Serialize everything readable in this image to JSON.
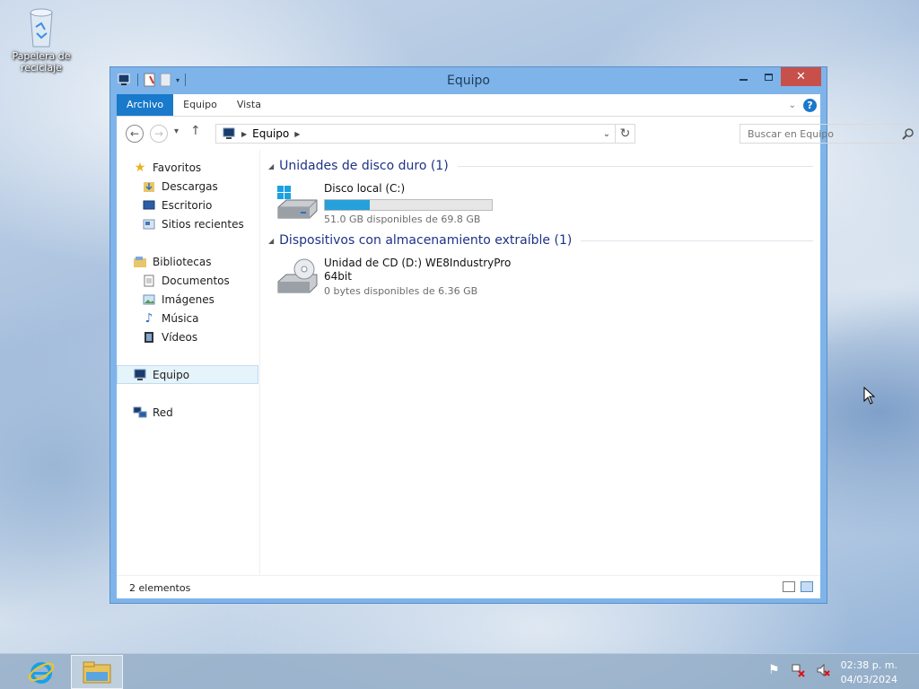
{
  "desktop": {
    "recycle_bin_label": "Papelera de reciclaje"
  },
  "window": {
    "title": "Equipo",
    "buttons": {
      "minimize": "minimize",
      "maximize": "maximize",
      "close": "✕"
    }
  },
  "ribbon": {
    "tabs": [
      "Archivo",
      "Equipo",
      "Vista"
    ],
    "active_tab": "Archivo",
    "help": "?"
  },
  "address_bar": {
    "path": "Equipo",
    "search_placeholder": "Buscar en Equipo"
  },
  "nav_pane": {
    "favorites": {
      "label": "Favoritos",
      "items": [
        "Descargas",
        "Escritorio",
        "Sitios recientes"
      ]
    },
    "libraries": {
      "label": "Bibliotecas",
      "items": [
        "Documentos",
        "Imágenes",
        "Música",
        "Vídeos"
      ]
    },
    "computer": "Equipo",
    "network": "Red"
  },
  "groups": [
    {
      "title": "Unidades de disco duro (1)",
      "drives": [
        {
          "name": "Disco local (C:)",
          "free_text": "51.0 GB disponibles de 69.8 GB",
          "used_fraction": 0.27,
          "icon": "windows-drive-icon"
        }
      ]
    },
    {
      "title": "Dispositivos con almacenamiento extraíble (1)",
      "drives": [
        {
          "name": "Unidad de CD (D:) WE8IndustryPro 64bit",
          "free_text": "0 bytes disponibles de 6.36 GB",
          "icon": "cd-drive-icon"
        }
      ]
    }
  ],
  "status_bar": {
    "text": "2 elementos"
  },
  "taskbar": {
    "time": "02:38 p. m.",
    "date": "04/03/2024"
  },
  "colors": {
    "accent": "#1979ca",
    "window_frame": "#7eb4ea",
    "progress_fill": "#26a0da",
    "group_title": "#1e3287"
  }
}
